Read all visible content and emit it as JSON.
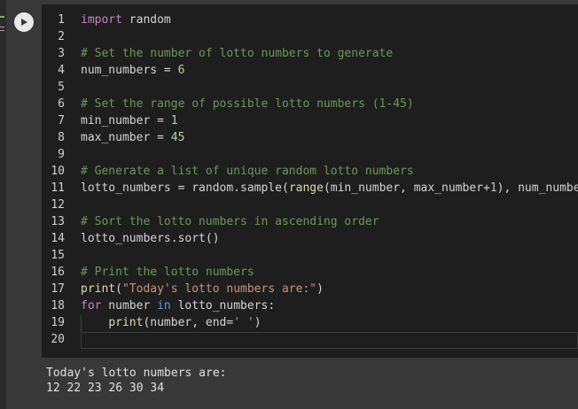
{
  "editor": {
    "line_numbers": [
      "1",
      "2",
      "3",
      "4",
      "5",
      "6",
      "7",
      "8",
      "9",
      "10",
      "11",
      "12",
      "13",
      "14",
      "15",
      "16",
      "17",
      "18",
      "19",
      "20"
    ],
    "lines": [
      {
        "segments": [
          {
            "t": "import",
            "c": "kw"
          },
          {
            "t": " random",
            "c": ""
          }
        ]
      },
      {
        "segments": []
      },
      {
        "segments": [
          {
            "t": "# Set the number of lotto numbers to generate",
            "c": "cm"
          }
        ]
      },
      {
        "segments": [
          {
            "t": "num_numbers = ",
            "c": ""
          },
          {
            "t": "6",
            "c": "num"
          }
        ]
      },
      {
        "segments": []
      },
      {
        "segments": [
          {
            "t": "# Set the range of possible lotto numbers (1-45)",
            "c": "cm"
          }
        ]
      },
      {
        "segments": [
          {
            "t": "min_number = ",
            "c": ""
          },
          {
            "t": "1",
            "c": "num"
          }
        ]
      },
      {
        "segments": [
          {
            "t": "max_number = ",
            "c": ""
          },
          {
            "t": "45",
            "c": "num"
          }
        ]
      },
      {
        "segments": []
      },
      {
        "segments": [
          {
            "t": "# Generate a list of unique random lotto numbers",
            "c": "cm"
          }
        ]
      },
      {
        "segments": [
          {
            "t": "lotto_numbers = random.sample(",
            "c": ""
          },
          {
            "t": "range",
            "c": "fn"
          },
          {
            "t": "(min_number, max_number+",
            "c": ""
          },
          {
            "t": "1",
            "c": "num"
          },
          {
            "t": "), num_numbers)",
            "c": ""
          }
        ]
      },
      {
        "segments": []
      },
      {
        "segments": [
          {
            "t": "# Sort the lotto numbers in ascending order",
            "c": "cm"
          }
        ]
      },
      {
        "segments": [
          {
            "t": "lotto_numbers.sort()",
            "c": ""
          }
        ]
      },
      {
        "segments": []
      },
      {
        "segments": [
          {
            "t": "# Print the lotto numbers",
            "c": "cm"
          }
        ]
      },
      {
        "segments": [
          {
            "t": "print",
            "c": "fn"
          },
          {
            "t": "(",
            "c": ""
          },
          {
            "t": "\"Today's lotto numbers are:\"",
            "c": "str"
          },
          {
            "t": ")",
            "c": ""
          }
        ]
      },
      {
        "segments": [
          {
            "t": "for",
            "c": "kw"
          },
          {
            "t": " number ",
            "c": ""
          },
          {
            "t": "in",
            "c": "kw-blue"
          },
          {
            "t": " lotto_numbers:",
            "c": ""
          }
        ]
      },
      {
        "segments": [
          {
            "t": "    ",
            "c": ""
          },
          {
            "t": "print",
            "c": "fn"
          },
          {
            "t": "(number, end=",
            "c": ""
          },
          {
            "t": "' '",
            "c": "str"
          },
          {
            "t": ")",
            "c": ""
          }
        ]
      },
      {
        "segments": []
      }
    ]
  },
  "output": {
    "lines": [
      "Today's lotto numbers are:",
      "12 22 23 26 30 34"
    ]
  },
  "icons": {
    "run": "play-icon"
  }
}
